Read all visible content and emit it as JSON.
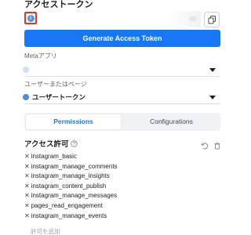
{
  "access_token": {
    "title": "アクセストークン",
    "info_icon": "info-icon",
    "copy_icon": "copy-icon",
    "generate_button": "Generate Access Token"
  },
  "meta_app": {
    "label": "Metaアプリ",
    "value": ""
  },
  "user_or_page": {
    "label": "ユーザーまたはページ",
    "value": "ユーザートークン"
  },
  "tabs": [
    {
      "label": "Permissions",
      "active": true
    },
    {
      "label": "Configurations",
      "active": false
    }
  ],
  "permissions": {
    "title": "アクセス許可",
    "title_icon": "help-icon",
    "undo_icon": "undo-icon",
    "delete_icon": "trash-icon",
    "items": [
      "instagram_basic",
      "instagram_manage_comments",
      "instagram_manage_insights",
      "instagram_content_publish",
      "instagram_manage_messages",
      "pages_read_engagement",
      "instagram_manage_events"
    ],
    "add_placeholder": "許可を追加"
  },
  "colors": {
    "accent": "#1877f2",
    "highlight": "#e0352b"
  }
}
